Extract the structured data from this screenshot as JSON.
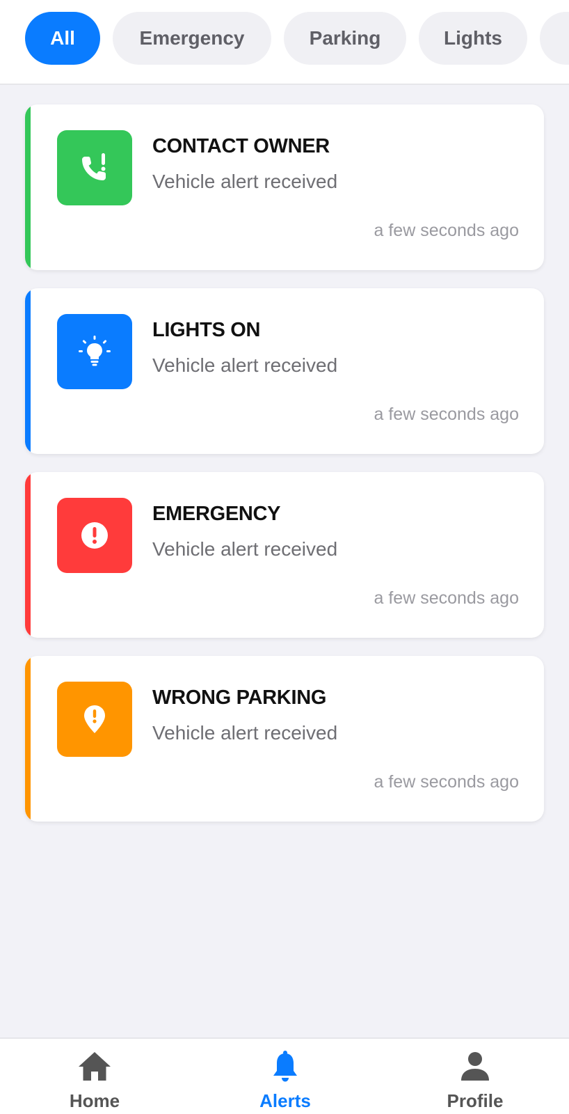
{
  "filters": {
    "chips": [
      {
        "label": "All",
        "active": true
      },
      {
        "label": "Emergency",
        "active": false
      },
      {
        "label": "Parking",
        "active": false
      },
      {
        "label": "Lights",
        "active": false
      }
    ]
  },
  "alerts": [
    {
      "title": "CONTACT OWNER",
      "subtitle": "Vehicle alert received",
      "time": "a few seconds ago",
      "icon": "phone-alert-icon",
      "color": "#34c759"
    },
    {
      "title": "LIGHTS ON",
      "subtitle": "Vehicle alert received",
      "time": "a few seconds ago",
      "icon": "lightbulb-icon",
      "color": "#0a7cff"
    },
    {
      "title": "EMERGENCY",
      "subtitle": "Vehicle alert received",
      "time": "a few seconds ago",
      "icon": "exclamation-circle-icon",
      "color": "#ff3b3b"
    },
    {
      "title": "WRONG PARKING",
      "subtitle": "Vehicle alert received",
      "time": "a few seconds ago",
      "icon": "location-alert-icon",
      "color": "#ff9500"
    }
  ],
  "nav": {
    "home": "Home",
    "alerts": "Alerts",
    "profile": "Profile",
    "active": "alerts"
  },
  "colors": {
    "accent": "#0a7cff",
    "background": "#f2f2f7"
  }
}
